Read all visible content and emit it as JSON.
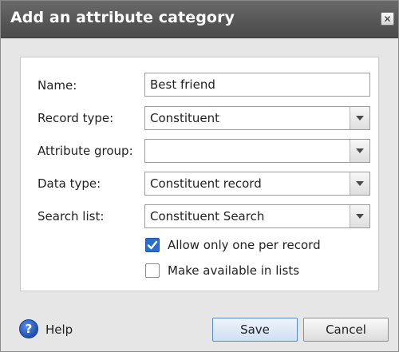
{
  "dialog": {
    "title": "Add an attribute category",
    "close_icon": "close-icon",
    "close_glyph": "✕"
  },
  "form": {
    "name": {
      "label": "Name:",
      "value": "Best friend"
    },
    "record_type": {
      "label": "Record type:",
      "value": "Constituent"
    },
    "attribute_group": {
      "label": "Attribute group:",
      "value": ""
    },
    "data_type": {
      "label": "Data type:",
      "value": "Constituent record"
    },
    "search_list": {
      "label": "Search list:",
      "value": "Constituent Search"
    },
    "allow_one": {
      "label": "Allow only one per record",
      "checked": true
    },
    "make_available": {
      "label": "Make available in lists",
      "checked": false
    }
  },
  "footer": {
    "help_icon": "help-icon",
    "help_glyph": "?",
    "help_label": "Help",
    "save_label": "Save",
    "cancel_label": "Cancel"
  },
  "colors": {
    "titlebar": "#555555",
    "checkbox_checked": "#2a6fd0",
    "primary_border": "#5b8cc9"
  }
}
